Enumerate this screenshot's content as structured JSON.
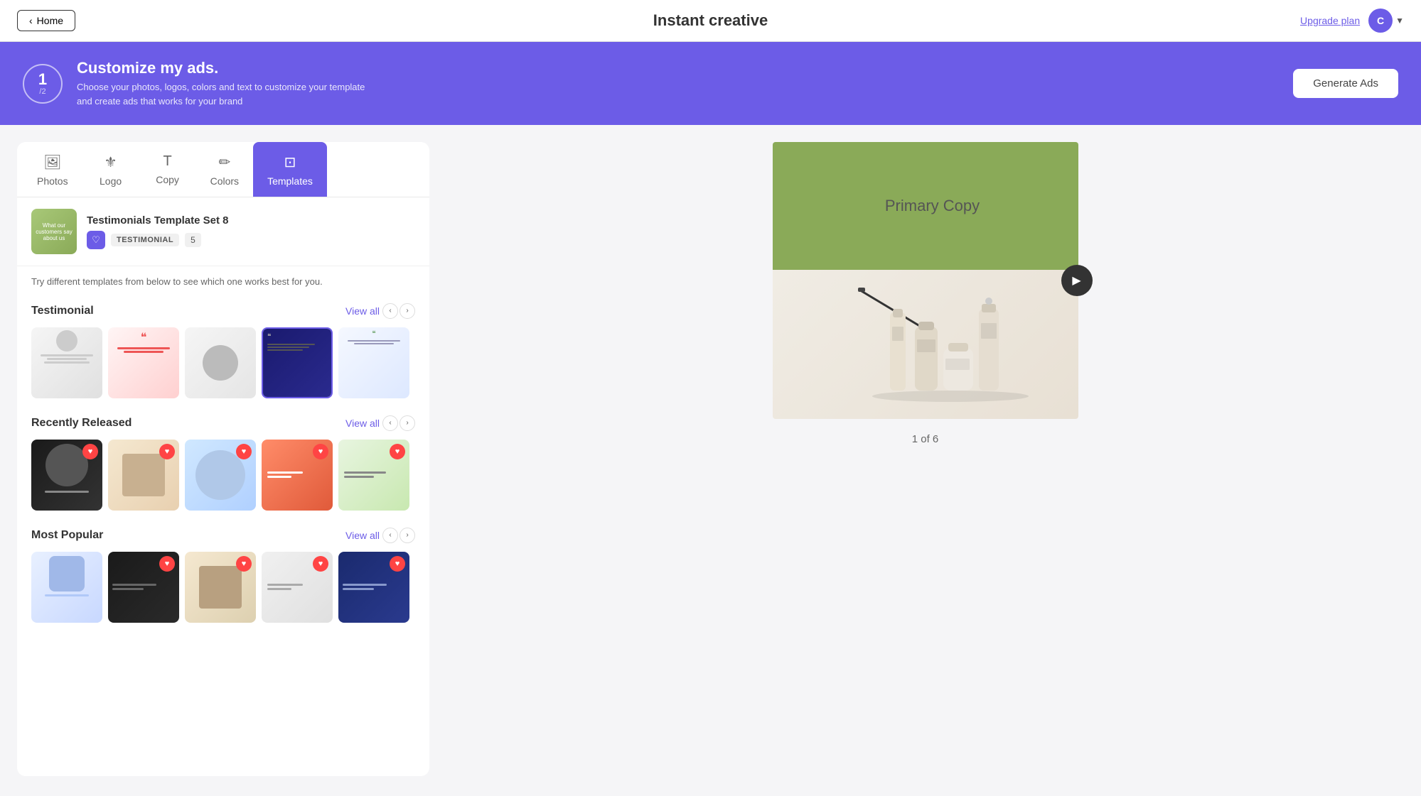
{
  "header": {
    "home_label": "Home",
    "title": "Instant creative",
    "upgrade_label": "Upgrade plan",
    "avatar_letter": "C"
  },
  "banner": {
    "step_num": "1",
    "step_total": "/2",
    "heading": "Customize my ads.",
    "description": "Choose your photos, logos, colors and text to customize your template and create ads that works for your brand",
    "generate_btn": "Generate Ads"
  },
  "tabs": [
    {
      "id": "photos",
      "label": "Photos",
      "icon": "🖼"
    },
    {
      "id": "logo",
      "label": "Logo",
      "icon": "⚜"
    },
    {
      "id": "copy",
      "label": "Copy",
      "icon": "T"
    },
    {
      "id": "colors",
      "label": "Colors",
      "icon": "✏"
    },
    {
      "id": "templates",
      "label": "Templates",
      "icon": "⊡",
      "active": true
    }
  ],
  "template_header": {
    "title": "Testimonials Template Set 8",
    "type_badge": "TESTIMONIAL",
    "count": "5"
  },
  "template_subtext": "Try different templates from below to see which one works best for you.",
  "sections": [
    {
      "id": "testimonial",
      "title": "Testimonial",
      "view_all": "View all",
      "cards": [
        {
          "id": 1,
          "style": "testimonial-1",
          "selected": false
        },
        {
          "id": 2,
          "style": "testimonial-2",
          "selected": false
        },
        {
          "id": 3,
          "style": "testimonial-3",
          "selected": false
        },
        {
          "id": 4,
          "style": "testimonial-4",
          "selected": true
        },
        {
          "id": 5,
          "style": "testimonial-5",
          "selected": false
        }
      ]
    },
    {
      "id": "recently-released",
      "title": "Recently Released",
      "view_all": "View all",
      "cards": [
        {
          "id": 1,
          "style": "recent-1",
          "heart": true
        },
        {
          "id": 2,
          "style": "recent-2",
          "heart": true
        },
        {
          "id": 3,
          "style": "recent-3",
          "heart": true
        },
        {
          "id": 4,
          "style": "recent-4",
          "heart": true
        },
        {
          "id": 5,
          "style": "recent-5",
          "heart": true
        }
      ]
    },
    {
      "id": "most-popular",
      "title": "Most Popular",
      "view_all": "View all",
      "cards": [
        {
          "id": 1,
          "style": "popular-1",
          "heart": false
        },
        {
          "id": 2,
          "style": "popular-2",
          "heart": true
        },
        {
          "id": 3,
          "style": "popular-3",
          "heart": true
        },
        {
          "id": 4,
          "style": "popular-4",
          "heart": true
        },
        {
          "id": 5,
          "style": "popular-5",
          "heart": true
        }
      ]
    }
  ],
  "preview": {
    "primary_copy": "Primary Copy",
    "page_indicator": "1 of 6"
  }
}
